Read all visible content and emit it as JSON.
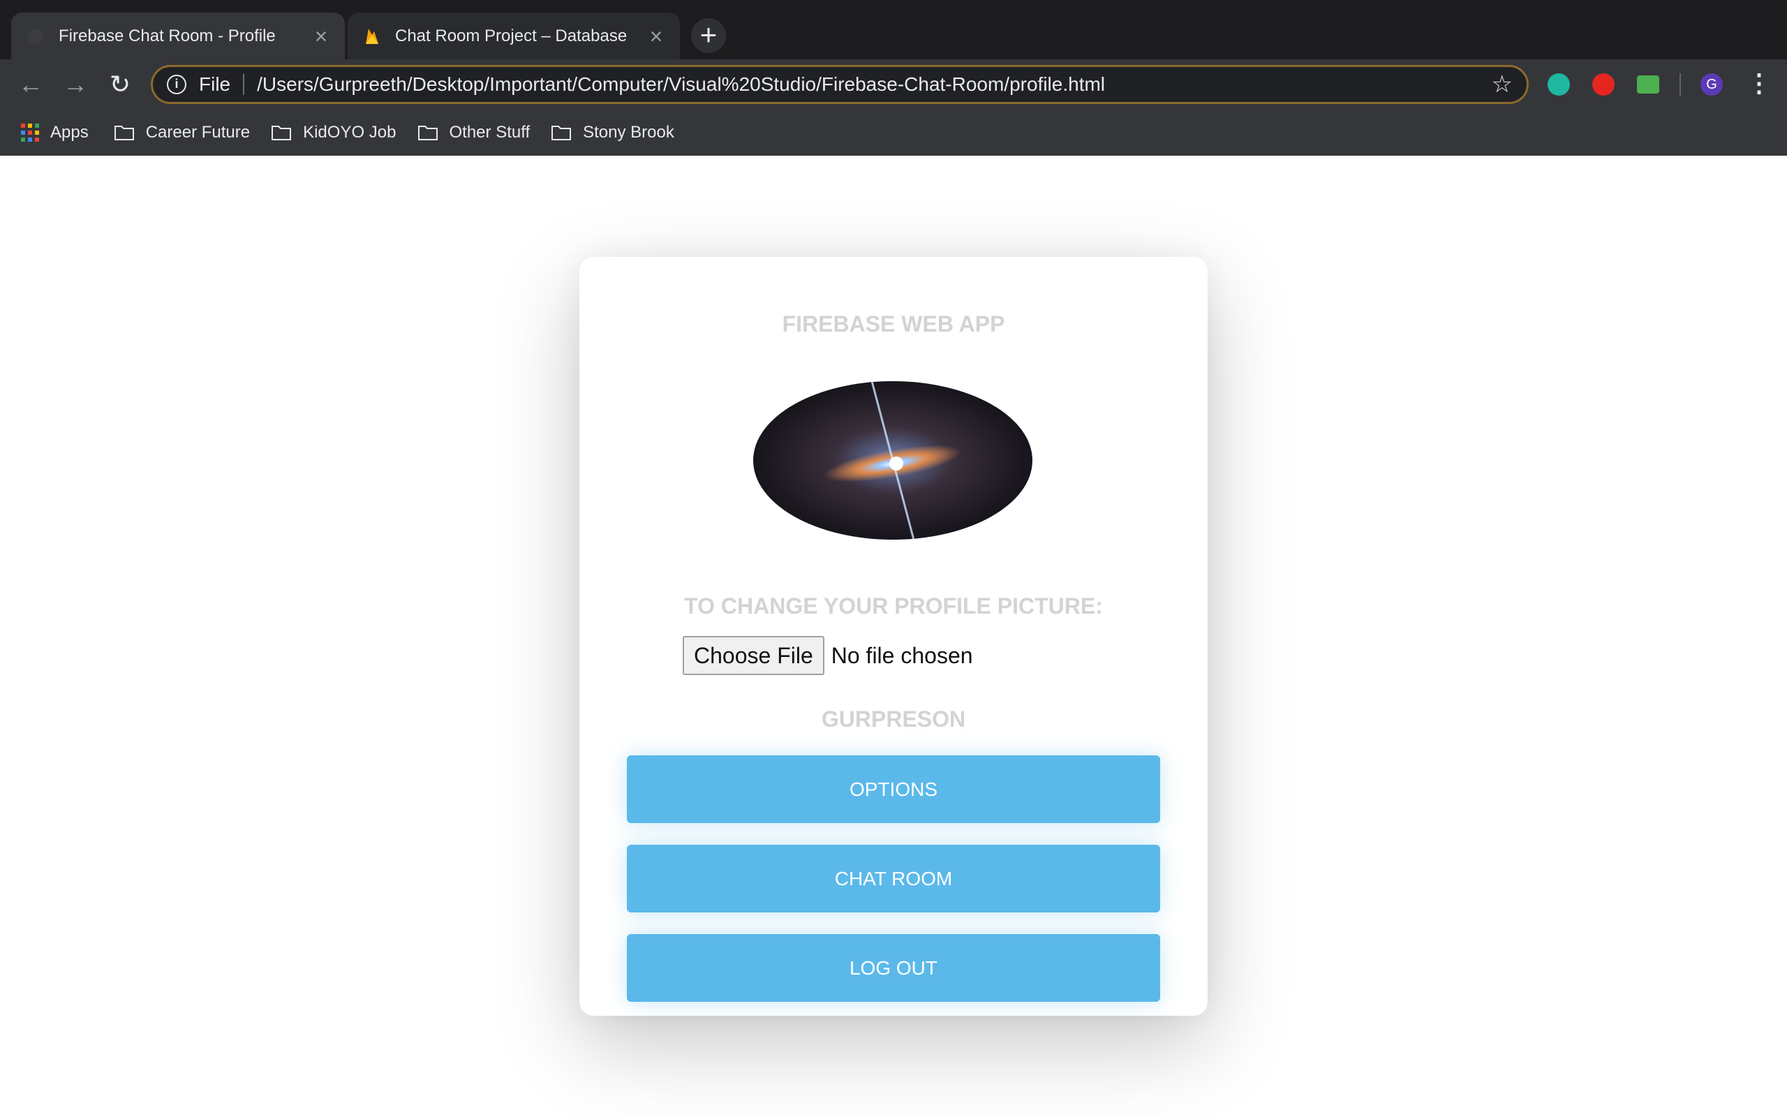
{
  "browser": {
    "tabs": [
      {
        "title": "Firebase Chat Room - Profile",
        "active": true
      },
      {
        "title": "Chat Room Project – Database",
        "active": false
      }
    ],
    "omnibox": {
      "scheme_label": "File",
      "url": "/Users/Gurpreeth/Desktop/Important/Computer/Visual%20Studio/Firebase-Chat-Room/profile.html"
    },
    "profile_initial": "G",
    "bookmarks": [
      {
        "label": "Apps",
        "icon": "apps-grid-icon"
      },
      {
        "label": "Career Future",
        "icon": "folder-icon"
      },
      {
        "label": "KidOYO Job",
        "icon": "folder-icon"
      },
      {
        "label": "Other Stuff",
        "icon": "folder-icon"
      },
      {
        "label": "Stony Brook",
        "icon": "folder-icon"
      }
    ]
  },
  "page": {
    "app_title": "FIREBASE WEB APP",
    "change_picture_label": "TO CHANGE YOUR PROFILE PICTURE:",
    "file_input": {
      "button_label": "Choose File",
      "status": "No file chosen"
    },
    "username": "GURPRESON",
    "buttons": {
      "options": "OPTIONS",
      "chat_room": "CHAT ROOM",
      "log_out": "LOG OUT"
    }
  },
  "colors": {
    "button": "#5bb9ea",
    "muted_heading": "#d3d3d3",
    "chrome_bg": "#35363a"
  }
}
